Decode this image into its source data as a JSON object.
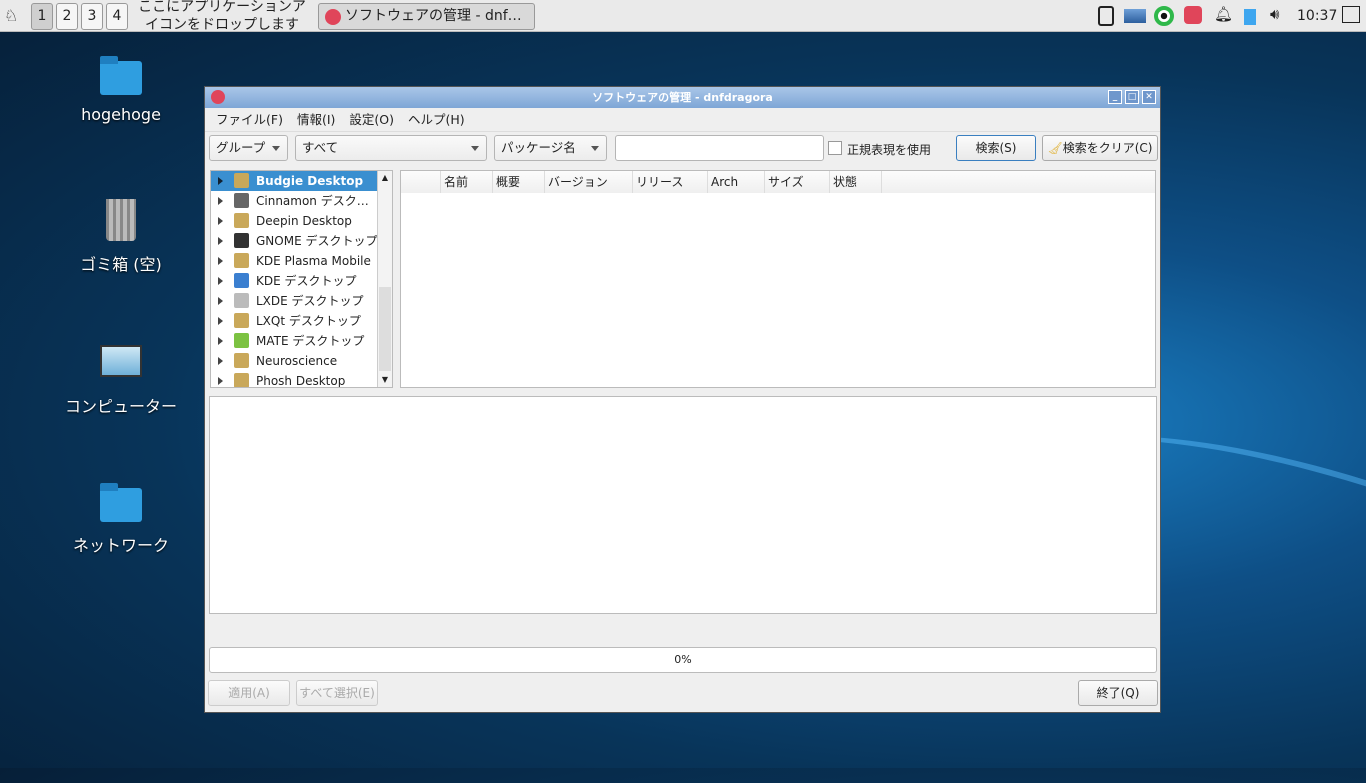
{
  "taskbar": {
    "workspaces": [
      "1",
      "2",
      "3",
      "4"
    ],
    "active_workspace": "1",
    "drop_hint": "ここにアプリケーションアイコンをドロップします",
    "task_button": "ソフトウェアの管理 - dnf…",
    "clock": "10:37"
  },
  "desktop": {
    "icons": [
      {
        "label": "hogehoge",
        "icon": "home-folder"
      },
      {
        "label": "ゴミ箱 (空)",
        "icon": "trash"
      },
      {
        "label": "コンピューター",
        "icon": "computer"
      },
      {
        "label": "ネットワーク",
        "icon": "network-folder"
      }
    ]
  },
  "window": {
    "title": "ソフトウェアの管理 - dnfdragora",
    "menu": [
      "ファイル(F)",
      "情報(I)",
      "設定(O)",
      "ヘルプ(H)"
    ],
    "toolbar": {
      "group_combo": "グループ",
      "filter_combo": "すべて",
      "field_combo": "パッケージ名",
      "search_value": "",
      "regex_label": "正規表現を使用",
      "regex_checked": false,
      "search_button": "検索(S)",
      "clear_button": "検索をクリア(C)"
    },
    "groups": [
      {
        "label": "Budgie Desktop",
        "selected": true,
        "color": "#c9a85a"
      },
      {
        "label": "Cinnamon デスク…",
        "color": "#666"
      },
      {
        "label": "Deepin Desktop",
        "color": "#c9a85a"
      },
      {
        "label": "GNOME デスクトップ",
        "color": "#333"
      },
      {
        "label": "KDE Plasma Mobile",
        "color": "#c9a85a"
      },
      {
        "label": "KDE デスクトップ",
        "color": "#3b7fd0"
      },
      {
        "label": "LXDE デスクトップ",
        "color": "#bbb"
      },
      {
        "label": "LXQt デスクトップ",
        "color": "#c9a85a"
      },
      {
        "label": "MATE デスクトップ",
        "color": "#7cc242"
      },
      {
        "label": "Neuroscience",
        "color": "#c9a85a"
      },
      {
        "label": "Phosh Desktop",
        "color": "#c9a85a"
      }
    ],
    "columns": [
      "",
      "名前",
      "概要",
      "バージョン",
      "リリース",
      "Arch",
      "サイズ",
      "状態"
    ],
    "progress_text": "0%",
    "progress_value": 0,
    "buttons": {
      "apply": "適用(A)",
      "select_all": "すべて選択(E)",
      "quit": "終了(Q)"
    }
  }
}
